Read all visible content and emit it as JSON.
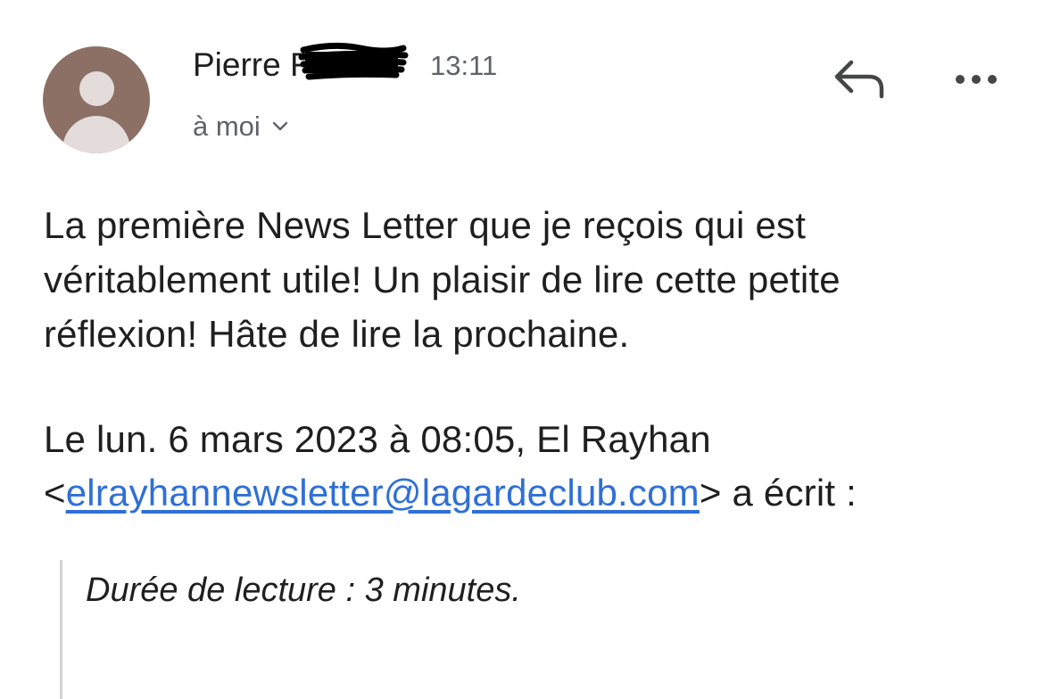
{
  "header": {
    "sender_name": "Pierre F",
    "time": "13:11",
    "recipient": "à moi",
    "icons": {
      "reply": "reply-arrow-icon",
      "more": "more-horizontal-icon",
      "expand": "chevron-down-icon",
      "avatar": "person-icon"
    },
    "colors": {
      "avatar_bg": "#8c7065",
      "link": "#2f6fd6",
      "secondary_text": "#5f6368"
    }
  },
  "message": {
    "lines": [
      "La première News Letter que je reçois qui est",
      "véritablement utile! Un plaisir de lire cette petite",
      "réflexion! Hâte de lire la prochaine."
    ]
  },
  "quote": {
    "intro": "Le lun. 6 mars 2023 à 08:05, El Rayhan",
    "open_bracket": "<",
    "email": "elrayhannewsletter@lagardeclub.com",
    "suffix": "> a écrit :",
    "quoted_text": "Durée de lecture : 3 minutes."
  }
}
